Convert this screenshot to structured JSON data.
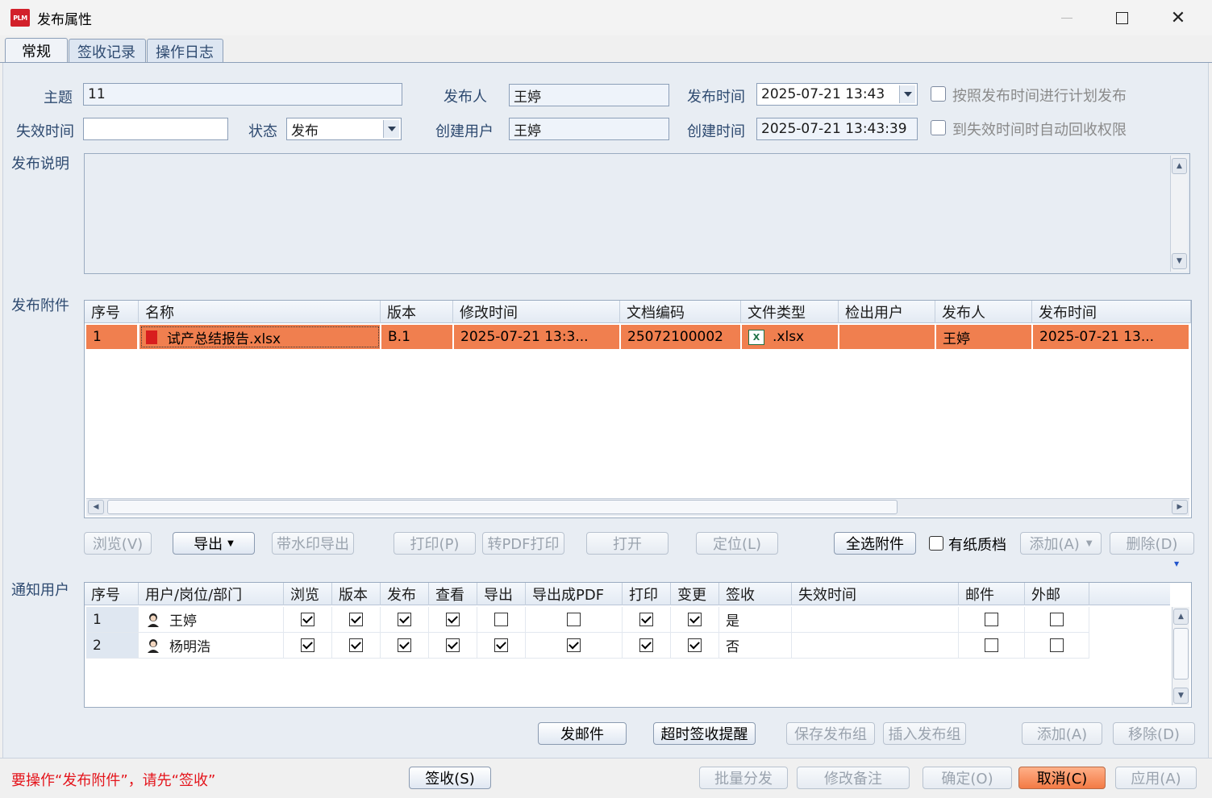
{
  "window": {
    "title": "发布属性",
    "logo": "PLM"
  },
  "tabs": [
    "常规",
    "签收记录",
    "操作日志"
  ],
  "form": {
    "subject_label": "主题",
    "subject_value": "11",
    "publisher_label": "发布人",
    "publisher_value": "王婷",
    "publish_time_label": "发布时间",
    "publish_time_value": "2025-07-21  13:43",
    "plan_publish_label": "按照发布时间进行计划发布",
    "expire_label": "失效时间",
    "expire_value": "",
    "status_label": "状态",
    "status_value": "发布",
    "creator_label": "创建用户",
    "creator_value": "王婷",
    "create_time_label": "创建时间",
    "create_time_value": "2025-07-21  13:43:39",
    "auto_revoke_label": "到失效时间时自动回收权限",
    "desc_label": "发布说明",
    "attachments_label": "发布附件",
    "notify_label": "通知用户"
  },
  "attachments": {
    "columns": [
      "序号",
      "名称",
      "版本",
      "修改时间",
      "文档编码",
      "文件类型",
      "检出用户",
      "发布人",
      "发布时间"
    ],
    "rows": [
      {
        "no": "1",
        "name": "试产总结报告.xlsx",
        "version": "B.1",
        "modified": "2025-07-21  13:3...",
        "code": "25072100002",
        "type": ".xlsx",
        "checkout": "",
        "publisher": "王婷",
        "time": "2025-07-21  13..."
      }
    ]
  },
  "attach_buttons": {
    "browse": "浏览(V)",
    "export": "导出",
    "export_wm": "带水印导出",
    "print": "打印(P)",
    "pdf_print": "转PDF打印",
    "open": "打开",
    "locate": "定位(L)",
    "select_all": "全选附件",
    "paper": "有纸质档",
    "add": "添加(A)",
    "delete": "删除(D)"
  },
  "users": {
    "columns": [
      "序号",
      "用户/岗位/部门",
      "浏览",
      "版本",
      "发布",
      "查看",
      "导出",
      "导出成PDF",
      "打印",
      "变更",
      "签收",
      "失效时间",
      "邮件",
      "外邮"
    ],
    "rows": [
      {
        "no": "1",
        "name": "王婷",
        "browse": true,
        "version": true,
        "publish": true,
        "view": true,
        "export": false,
        "pdf": false,
        "print": true,
        "change": true,
        "sign": "是",
        "expire": "",
        "mail": false,
        "extmail": false
      },
      {
        "no": "2",
        "name": "杨明浩",
        "browse": true,
        "version": true,
        "publish": true,
        "view": true,
        "export": true,
        "pdf": true,
        "print": true,
        "change": true,
        "sign": "否",
        "expire": "",
        "mail": false,
        "extmail": false
      }
    ]
  },
  "user_buttons": {
    "send_mail": "发邮件",
    "overdue": "超时签收提醒",
    "save_group": "保存发布组",
    "insert_group": "插入发布组",
    "add": "添加(A)",
    "remove": "移除(D)"
  },
  "footer": {
    "warning": "要操作“发布附件”，请先“签收”",
    "sign": "签收(S)",
    "batch": "批量分发",
    "edit_note": "修改备注",
    "ok": "确定(O)",
    "cancel": "取消(C)",
    "apply": "应用(A)"
  },
  "colors": {
    "selection": "#f07f4f",
    "label": "#2e4a70",
    "warning": "#e4141b"
  }
}
